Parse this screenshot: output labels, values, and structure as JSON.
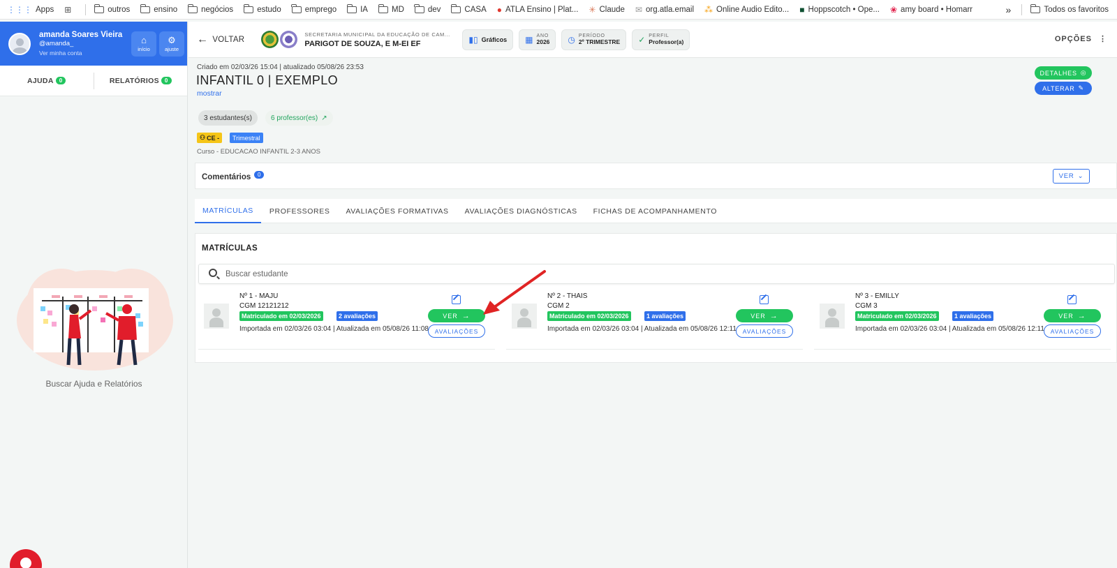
{
  "bookmarks": [
    {
      "label": "Apps",
      "icon": "apps-grid-icon"
    },
    {
      "label": "",
      "icon": "tab-groups-icon"
    },
    {
      "label": "outros",
      "icon": "folder-icon"
    },
    {
      "label": "ensino",
      "icon": "folder-icon"
    },
    {
      "label": "negócios",
      "icon": "folder-icon"
    },
    {
      "label": "estudo",
      "icon": "folder-icon"
    },
    {
      "label": "emprego",
      "icon": "folder-icon"
    },
    {
      "label": "IA",
      "icon": "folder-icon"
    },
    {
      "label": "MD",
      "icon": "folder-icon"
    },
    {
      "label": "dev",
      "icon": "folder-icon"
    },
    {
      "label": "CASA",
      "icon": "folder-icon"
    },
    {
      "label": "ATLA Ensino | Plat...",
      "icon": "atla-icon"
    },
    {
      "label": "Claude",
      "icon": "claude-icon"
    },
    {
      "label": "org.atla.email",
      "icon": "mail-icon"
    },
    {
      "label": "Online Audio Edito...",
      "icon": "audio-icon"
    },
    {
      "label": "Hoppscotch • Ope...",
      "icon": "hoppscotch-icon"
    },
    {
      "label": "amy board • Homarr",
      "icon": "homarr-icon"
    }
  ],
  "bookmarks_more": "»",
  "bookmarks_all": "Todos os favoritos",
  "user": {
    "name": "amanda Soares Vieira",
    "handle": "@amanda_",
    "link": "Ver minha conta",
    "btn_home": "início",
    "btn_settings": "ajuste"
  },
  "sidebar": {
    "help_label": "AJUDA",
    "help_count": "0",
    "reports_label": "RELATÓRIOS",
    "reports_count": "0",
    "caption": "Buscar Ajuda e Relatórios"
  },
  "header": {
    "back_label": "VOLTAR",
    "secretaria": "SECRETARIA MUNICIPAL DA EDUCAÇÃO DE CAM...",
    "school": "PARIGOT DE SOUZA, E M-EI EF",
    "graficos": "Gráficos",
    "ano_label": "ANO",
    "ano_value": "2026",
    "periodo_label": "PERÍODO",
    "periodo_value": "2º TRIMESTRE",
    "perfil_label": "PERFIL",
    "perfil_value": "Professor(a)",
    "opcoes": "OPÇÕES"
  },
  "class_info": {
    "created": "Criado em 02/03/26 15:04 | atualizado 05/08/26 23:53",
    "title": "INFANTIL 0 | EXEMPLO",
    "mostrar": "mostrar",
    "students_chip": "3 estudantes(s)",
    "prof_chip": "6 professor(es)",
    "tag_ce": "CE -",
    "tag_periodicity": "Trimestral",
    "curso": "Curso - EDUCACAO INFANTIL 2-3 ANOS",
    "btn_detalhes": "DETALHES",
    "btn_alterar": "ALTERAR"
  },
  "comments": {
    "title": "Comentários",
    "count": "0",
    "ver": "VER"
  },
  "tabs": [
    {
      "label": "MATRÍCULAS",
      "active": true
    },
    {
      "label": "PROFESSORES",
      "active": false
    },
    {
      "label": "AVALIAÇÕES FORMATIVAS",
      "active": false
    },
    {
      "label": "AVALIAÇÕES DIAGNÓSTICAS",
      "active": false
    },
    {
      "label": "FICHAS DE ACOMPANHAMENTO",
      "active": false
    }
  ],
  "matriculas": {
    "title": "MATRÍCULAS",
    "search_placeholder": "Buscar estudante",
    "ver_label": "VER",
    "aval_label": "AVALIAÇÕES",
    "students": [
      {
        "num": "Nº 1 - MAJU",
        "cgm": "CGM 12121212",
        "matriculado": "Matriculado em 02/03/2026",
        "avaliacoes": "2 avaliações",
        "meta": "Importada em 02/03/26 03:04 | Atualizada em 05/08/26 11:08"
      },
      {
        "num": "Nº 2 - THAIS",
        "cgm": "CGM 2",
        "matriculado": "Matriculado em 02/03/2026",
        "avaliacoes": "1 avaliações",
        "meta": "Importada em 02/03/26 03:04 | Atualizada em 05/08/26 12:11"
      },
      {
        "num": "Nº 3 - EMILLY",
        "cgm": "CGM 3",
        "matriculado": "Matriculado em 02/03/2026",
        "avaliacoes": "1 avaliações",
        "meta": "Importada em 02/03/26 03:04 | Atualizada em 05/08/26 12:11"
      }
    ]
  },
  "colors": {
    "primary": "#2f6fea",
    "success": "#22c55e",
    "annotation_arrow": "#e02424"
  }
}
